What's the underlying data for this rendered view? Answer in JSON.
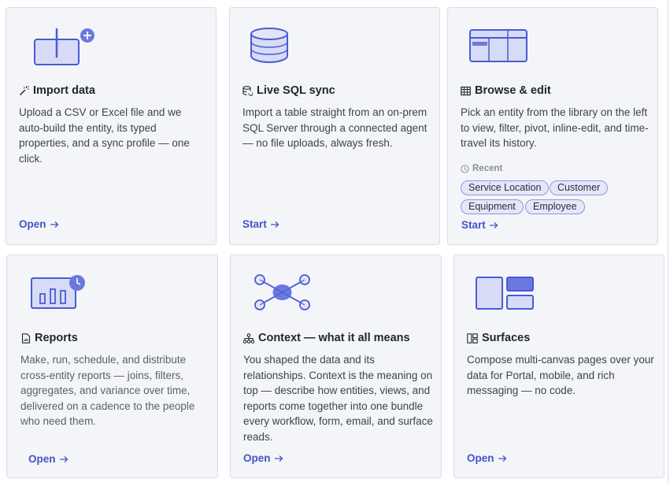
{
  "cards": [
    {
      "title": "Import data",
      "description": "Upload a CSV or Excel file and we auto-build the entity, its typed properties, and a sync profile — one click.",
      "action": "Open"
    },
    {
      "title": "Live SQL sync",
      "description": "Import a table straight from an on-prem SQL Server through a connected agent — no file uploads, always fresh.",
      "action": "Start"
    },
    {
      "title": "Browse & edit",
      "description": "Pick an entity from the library on the left to view, filter, pivot, inline-edit, and time-travel its history.",
      "recent_label": "Recent",
      "recent_items": [
        "Service Location",
        "Customer",
        "Equipment",
        "Employee"
      ],
      "action": "Start"
    },
    {
      "title": "Reports",
      "description": "Make, run, schedule, and distribute cross-entity reports — joins, filters, aggregates, and variance over time, delivered on a cadence to the people who need them.",
      "action": "Open"
    },
    {
      "title": "Context — what it all means",
      "description": "You shaped the data and its relationships. Context is the meaning on top — describe how entities, views, and reports come together into one bundle every workflow, form, email, and surface reads.",
      "action": "Open"
    },
    {
      "title": "Surfaces",
      "description": "Compose multi-canvas pages over your data for Portal, mobile, and rich messaging — no code.",
      "action": "Open"
    }
  ],
  "icons": {
    "import": "magic-wand-icon",
    "sql": "database-icon",
    "browse": "table-icon",
    "reports": "report-file-icon",
    "context": "hierarchy-icon",
    "surfaces": "layout-icon",
    "recent": "clock-icon",
    "arrow": "arrow-right-icon"
  },
  "colors": {
    "accent": "#4454c6",
    "illustration_stroke": "#4a5bd4",
    "illustration_fill": "#d7dbf5",
    "card_bg": "#f4f5f9",
    "chip_bg": "#e4e7f8"
  }
}
